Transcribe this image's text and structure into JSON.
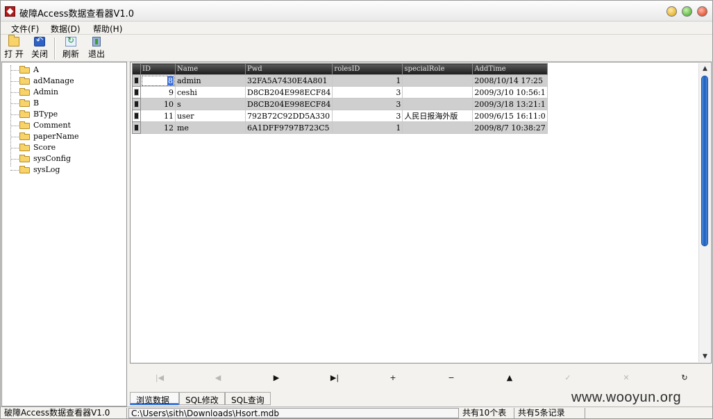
{
  "window": {
    "title": "破障Access数据查看器V1.0"
  },
  "menu": [
    {
      "label": "文件(F)"
    },
    {
      "label": "数据(D)"
    },
    {
      "label": "帮助(H)"
    }
  ],
  "toolbar": {
    "open_label": "打 开",
    "close_label": "关闭",
    "refresh_label": "刷新",
    "exit_label": "退出"
  },
  "tree": {
    "items": [
      "A",
      "adManage",
      "Admin",
      "B",
      "BType",
      "Comment",
      "paperName",
      "Score",
      "sysConfig",
      "sysLog"
    ]
  },
  "grid": {
    "columns": [
      "ID",
      "Name",
      "Pwd",
      "rolesID",
      "specialRole",
      "AddTime"
    ],
    "rows": [
      {
        "ID": "8",
        "Name": "admin",
        "Pwd": "32FA5A7430E4A801",
        "rolesID": "1",
        "specialRole": "",
        "AddTime": "2008/10/14 17:25"
      },
      {
        "ID": "9",
        "Name": "ceshi",
        "Pwd": "D8CB204E998ECF84",
        "rolesID": "3",
        "specialRole": "",
        "AddTime": "2009/3/10 10:56:1"
      },
      {
        "ID": "10",
        "Name": "s",
        "Pwd": "D8CB204E998ECF84",
        "rolesID": "3",
        "specialRole": "",
        "AddTime": "2009/3/18 13:21:1"
      },
      {
        "ID": "11",
        "Name": "user",
        "Pwd": "792B72C92DD5A330",
        "rolesID": "3",
        "specialRole": "人民日报海外版",
        "AddTime": "2009/6/15 16:11:0"
      },
      {
        "ID": "12",
        "Name": "me",
        "Pwd": "6A1DFF9797B723C5",
        "rolesID": "1",
        "specialRole": "",
        "AddTime": "2009/8/7 10:38:27"
      }
    ]
  },
  "navigator": {
    "buttons": [
      {
        "name": "first-record-button",
        "glyph": "|◀",
        "enabled": false
      },
      {
        "name": "prior-record-button",
        "glyph": "◀",
        "enabled": false
      },
      {
        "name": "next-record-button",
        "glyph": "▶",
        "enabled": true
      },
      {
        "name": "last-record-button",
        "glyph": "▶|",
        "enabled": true
      },
      {
        "name": "insert-record-button",
        "glyph": "+",
        "enabled": true
      },
      {
        "name": "delete-record-button",
        "glyph": "−",
        "enabled": true
      },
      {
        "name": "edit-record-button",
        "glyph": "▲",
        "enabled": true
      },
      {
        "name": "post-record-button",
        "glyph": "✓",
        "enabled": false
      },
      {
        "name": "cancel-record-button",
        "glyph": "✕",
        "enabled": false
      },
      {
        "name": "refresh-record-button",
        "glyph": "↻",
        "enabled": true
      }
    ]
  },
  "tabs": [
    {
      "label": "浏览数据",
      "active": true
    },
    {
      "label": "SQL修改",
      "active": false
    },
    {
      "label": "SQL查询",
      "active": false
    }
  ],
  "status": {
    "app": "破障Access数据查看器V1.0",
    "path": "C:\\Users\\sith\\Downloads\\Hsort.mdb",
    "table_count": "共有10个表",
    "record_count": "共有5条记录"
  },
  "watermark": "www.wooyun.org"
}
